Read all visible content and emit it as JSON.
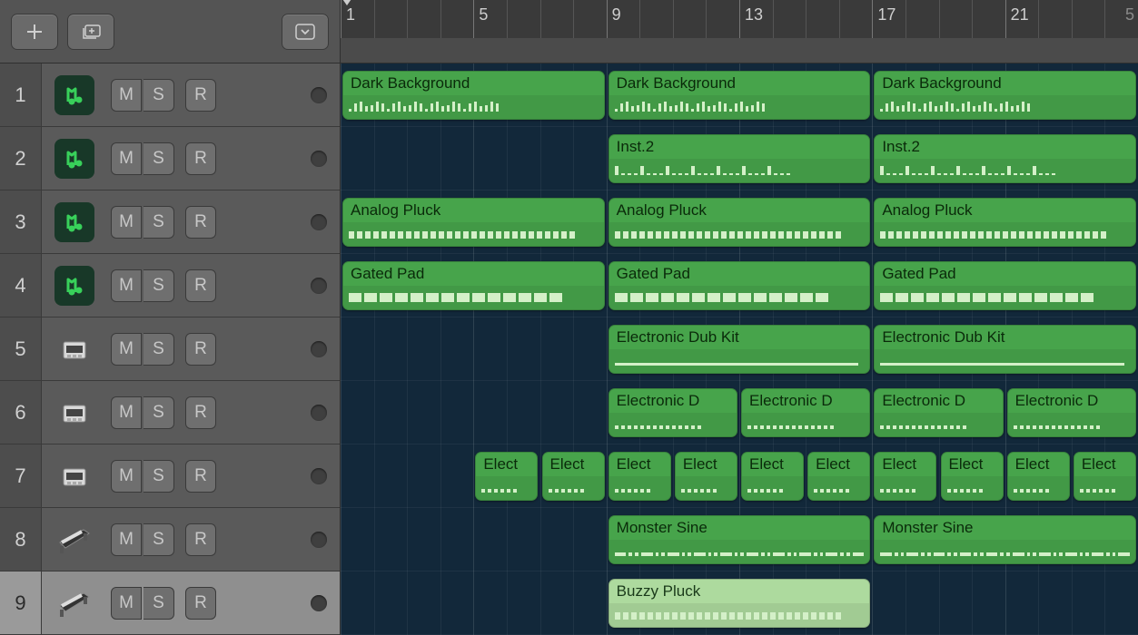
{
  "timeline": {
    "start_bar": 1,
    "bars_visible": 25,
    "labeled_bars": [
      1,
      5,
      9,
      13,
      17,
      21
    ],
    "end_label": "5",
    "playhead_bar": 1
  },
  "toolbar": {
    "add_label": "+",
    "add_track_label": "+",
    "dropdown_label": "▾"
  },
  "buttons": {
    "mute": "M",
    "solo": "S",
    "record_enable": "R"
  },
  "tracks": [
    {
      "num": "1",
      "icon": "midi",
      "selected": false
    },
    {
      "num": "2",
      "icon": "midi",
      "selected": false
    },
    {
      "num": "3",
      "icon": "midi",
      "selected": false
    },
    {
      "num": "4",
      "icon": "midi",
      "selected": false
    },
    {
      "num": "5",
      "icon": "drum",
      "selected": false
    },
    {
      "num": "6",
      "icon": "drum",
      "selected": false
    },
    {
      "num": "7",
      "icon": "drum",
      "selected": false
    },
    {
      "num": "8",
      "icon": "keys",
      "selected": false
    },
    {
      "num": "9",
      "icon": "keys",
      "selected": true
    }
  ],
  "regions": [
    {
      "track": 0,
      "name": "Dark Background",
      "start": 1,
      "len": 8,
      "pattern": "wave"
    },
    {
      "track": 0,
      "name": "Dark Background",
      "start": 9,
      "len": 8,
      "pattern": "wave"
    },
    {
      "track": 0,
      "name": "Dark Background",
      "start": 17,
      "len": 8,
      "pattern": "wave"
    },
    {
      "track": 1,
      "name": "Inst.2",
      "start": 9,
      "len": 8,
      "pattern": "sparse"
    },
    {
      "track": 1,
      "name": "Inst.2",
      "start": 17,
      "len": 8,
      "pattern": "sparse"
    },
    {
      "track": 2,
      "name": "Analog Pluck",
      "start": 1,
      "len": 8,
      "pattern": "solid"
    },
    {
      "track": 2,
      "name": "Analog Pluck",
      "start": 9,
      "len": 8,
      "pattern": "solid"
    },
    {
      "track": 2,
      "name": "Analog Pluck",
      "start": 17,
      "len": 8,
      "pattern": "solid"
    },
    {
      "track": 3,
      "name": "Gated Pad",
      "start": 1,
      "len": 8,
      "pattern": "dashed"
    },
    {
      "track": 3,
      "name": "Gated Pad",
      "start": 9,
      "len": 8,
      "pattern": "dashed"
    },
    {
      "track": 3,
      "name": "Gated Pad",
      "start": 17,
      "len": 8,
      "pattern": "dashed"
    },
    {
      "track": 4,
      "name": "Electronic Dub Kit",
      "start": 9,
      "len": 8,
      "pattern": "line"
    },
    {
      "track": 4,
      "name": "Electronic Dub Kit",
      "start": 17,
      "len": 8,
      "pattern": "line"
    },
    {
      "track": 5,
      "name": "Electronic D",
      "start": 9,
      "len": 4,
      "pattern": "dots"
    },
    {
      "track": 5,
      "name": "Electronic D",
      "start": 13,
      "len": 4,
      "pattern": "dots"
    },
    {
      "track": 5,
      "name": "Electronic D",
      "start": 17,
      "len": 4,
      "pattern": "dots"
    },
    {
      "track": 5,
      "name": "Electronic D",
      "start": 21,
      "len": 4,
      "pattern": "dots"
    },
    {
      "track": 6,
      "name": "Elect",
      "start": 5,
      "len": 2,
      "pattern": "dots"
    },
    {
      "track": 6,
      "name": "Elect",
      "start": 7,
      "len": 2,
      "pattern": "dots"
    },
    {
      "track": 6,
      "name": "Elect",
      "start": 9,
      "len": 2,
      "pattern": "dots"
    },
    {
      "track": 6,
      "name": "Elect",
      "start": 11,
      "len": 2,
      "pattern": "dots"
    },
    {
      "track": 6,
      "name": "Elect",
      "start": 13,
      "len": 2,
      "pattern": "dots"
    },
    {
      "track": 6,
      "name": "Elect",
      "start": 15,
      "len": 2,
      "pattern": "dots"
    },
    {
      "track": 6,
      "name": "Elect",
      "start": 17,
      "len": 2,
      "pattern": "dots"
    },
    {
      "track": 6,
      "name": "Elect",
      "start": 19,
      "len": 2,
      "pattern": "dots"
    },
    {
      "track": 6,
      "name": "Elect",
      "start": 21,
      "len": 2,
      "pattern": "dots"
    },
    {
      "track": 6,
      "name": "Elect",
      "start": 23,
      "len": 2,
      "pattern": "dots"
    },
    {
      "track": 7,
      "name": "Monster Sine",
      "start": 9,
      "len": 8,
      "pattern": "dashdot"
    },
    {
      "track": 7,
      "name": "Monster Sine",
      "start": 17,
      "len": 8,
      "pattern": "dashdot"
    },
    {
      "track": 8,
      "name": "Buzzy Pluck",
      "start": 9,
      "len": 8,
      "pattern": "solid",
      "selected": true
    }
  ]
}
